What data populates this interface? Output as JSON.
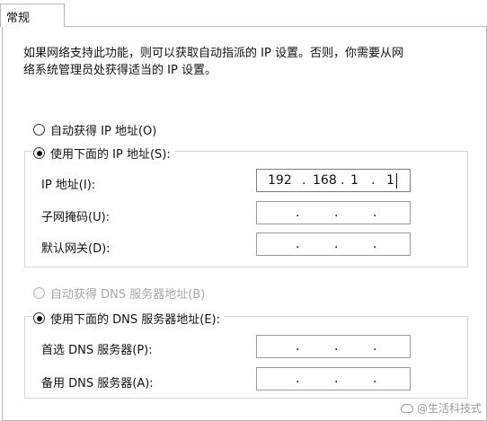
{
  "tab": {
    "label": "常规"
  },
  "description": "如果网络支持此功能，则可以获取自动指派的 IP 设置。否则，你需要从网\n络系统管理员处获得适当的 IP 设置。",
  "ip": {
    "auto_label": "自动获得 IP 地址(O)",
    "manual_label": "使用下面的 IP 地址(S):",
    "address_label": "IP 地址(I):",
    "address_octets": [
      "192",
      "168",
      "1",
      "1"
    ],
    "subnet_label": "子网掩码(U):",
    "gateway_label": "默认网关(D):"
  },
  "dns": {
    "auto_label": "自动获得 DNS 服务器地址(B)",
    "manual_label": "使用下面的 DNS 服务器地址(E):",
    "preferred_label": "首选 DNS 服务器(P):",
    "alternate_label": "备用 DNS 服务器(A):"
  },
  "watermark": {
    "text": "@生活科技式"
  }
}
